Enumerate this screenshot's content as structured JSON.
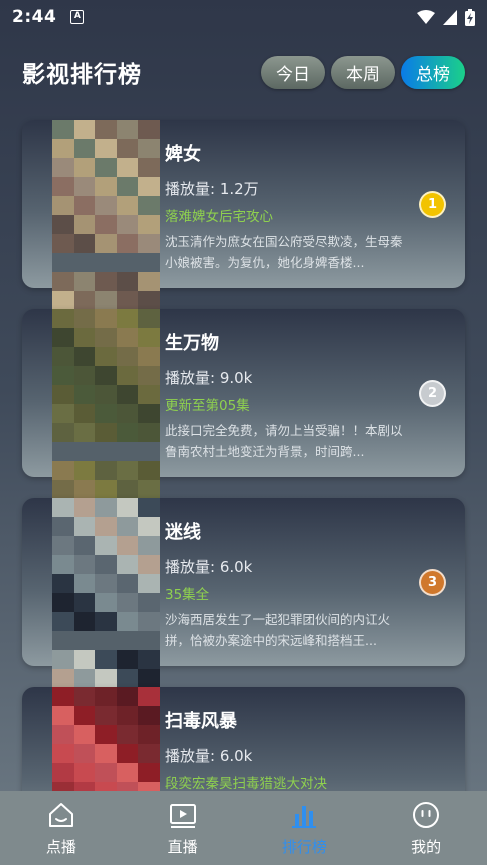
{
  "status_bar": {
    "time": "2:44",
    "icons": [
      "notification-a-icon",
      "wifi-icon",
      "signal-icon",
      "battery-charging-icon"
    ]
  },
  "header": {
    "title": "影视排行榜",
    "tabs": [
      {
        "label": "今日",
        "active": false
      },
      {
        "label": "本周",
        "active": false
      },
      {
        "label": "总榜",
        "active": true
      }
    ]
  },
  "items": [
    {
      "rank": "1",
      "rank_color": "#f2c300",
      "title": "婢女",
      "plays": "播放量: 1.2万",
      "tagline": "落难婢女后宅攻心",
      "desc": "沈玉清作为庶女在国公府受尽欺凌，生母秦小娘被害。为复仇，她化身婢香楼..."
    },
    {
      "rank": "2",
      "rank_color": "#c7cbcf",
      "title": "生万物",
      "plays": "播放量: 9.0k",
      "tagline": "更新至第05集",
      "desc": "此接口完全免费，请勿上当受骗！！本剧以鲁南农村土地变迁为背景，时间跨..."
    },
    {
      "rank": "3",
      "rank_color": "#d0782c",
      "title": "迷线",
      "plays": "播放量: 6.0k",
      "tagline": "35集全",
      "desc": "沙海西居发生了一起犯罪团伙间的内讧火拼，恰被办案途中的宋远峰和搭档王..."
    },
    {
      "rank": "",
      "rank_color": "",
      "title": "扫毒风暴",
      "plays": "播放量: 6.0k",
      "tagline": "段奕宏秦昊扫毒猎逃大对决",
      "desc": ""
    }
  ],
  "bottom_nav": [
    {
      "label": "点播",
      "icon": "home-icon",
      "active": false
    },
    {
      "label": "直播",
      "icon": "play-screen-icon",
      "active": false
    },
    {
      "label": "排行榜",
      "icon": "bar-chart-icon",
      "active": true
    },
    {
      "label": "我的",
      "icon": "profile-face-icon",
      "active": false
    }
  ],
  "colors": {
    "accent": "#2f8fef",
    "tag_green": "#8fd14f",
    "tab_gradient_start": "#0a7be8",
    "tab_gradient_end": "#1bd089"
  }
}
